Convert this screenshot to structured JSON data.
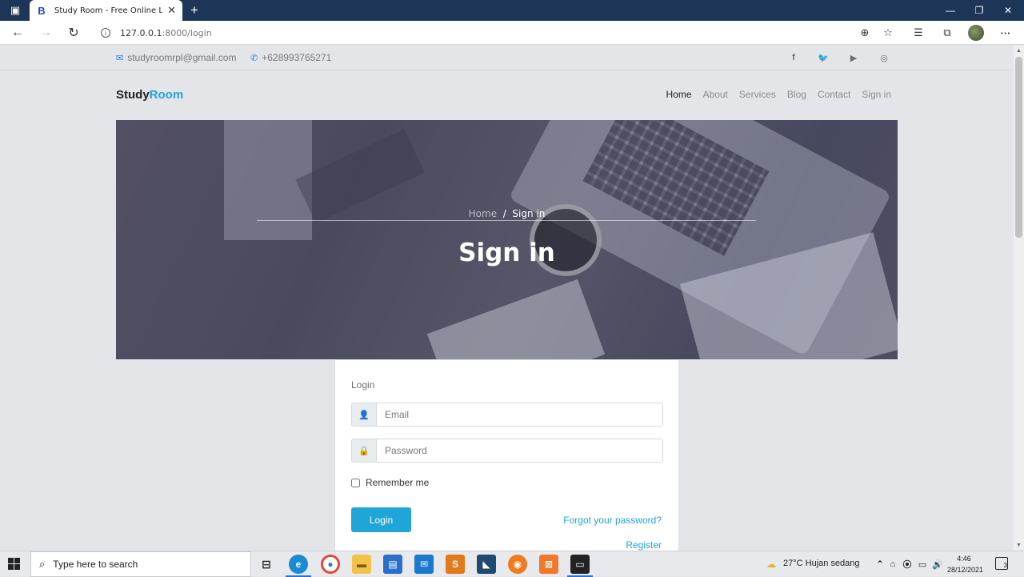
{
  "browser": {
    "tab_title": "Study Room - Free Online Learni",
    "tab_favicon": "B",
    "url_host": "127.0.0.1",
    "url_path": ":8000/login"
  },
  "topbar": {
    "email": "studyroomrpl@gmail.com",
    "phone": "+628993765271",
    "social": [
      "f",
      "t",
      "y",
      "ig"
    ]
  },
  "nav": {
    "brand_primary": "Study",
    "brand_accent": "Room",
    "items": [
      "Home",
      "About",
      "Services",
      "Blog",
      "Contact",
      "Sign in"
    ]
  },
  "hero": {
    "crumb_home": "Home",
    "crumb_sep": "/",
    "crumb_current": "Sign in",
    "title": "Sign in"
  },
  "login": {
    "label": "Login",
    "email_placeholder": "Email",
    "password_placeholder": "Password",
    "remember": "Remember me",
    "button": "Login",
    "forgot": "Forgot your password?",
    "register": "Register"
  },
  "taskbar": {
    "search_placeholder": "Type here to search",
    "weather": "27°C  Hujan sedang",
    "time": "4:46",
    "date": "28/12/2021",
    "notifications": "3"
  },
  "colors": {
    "accent": "#1fa5d6",
    "titlebar": "#1d3557"
  }
}
